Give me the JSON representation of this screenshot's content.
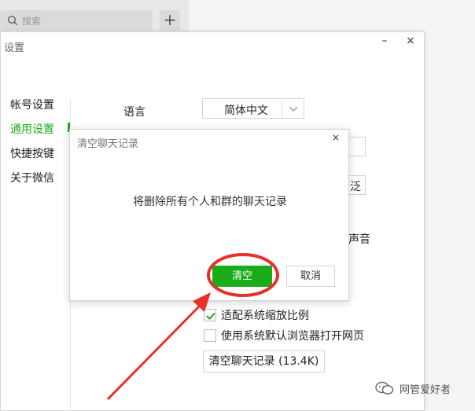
{
  "background": {
    "search": {
      "placeholder": "搜索",
      "icon": "search-icon"
    },
    "add_label": "+"
  },
  "settings": {
    "title": "设置",
    "minimize_label": "–",
    "close_label": "×",
    "nav": [
      {
        "label": "帐号设置"
      },
      {
        "label": "通用设置",
        "active": true
      },
      {
        "label": "快捷按键"
      },
      {
        "label": "关于微信"
      }
    ],
    "language": {
      "label": "语言",
      "value": "简体中文"
    },
    "partial_texts": [
      "泛",
      "声音"
    ],
    "checkboxes": [
      {
        "label": "适配系统缩放比例",
        "checked": true
      },
      {
        "label": "使用系统默认浏览器打开网页",
        "checked": false
      }
    ],
    "clear_history_label": "清空聊天记录 (13.4K)"
  },
  "dialog": {
    "title": "清空聊天记录",
    "close_label": "×",
    "message": "将删除所有个人和群的聊天记录",
    "confirm_label": "清空",
    "cancel_label": "取消"
  },
  "watermark": {
    "text": "网管爱好者"
  },
  "colors": {
    "accent": "#1aad19",
    "annotation": "#e8302a"
  }
}
